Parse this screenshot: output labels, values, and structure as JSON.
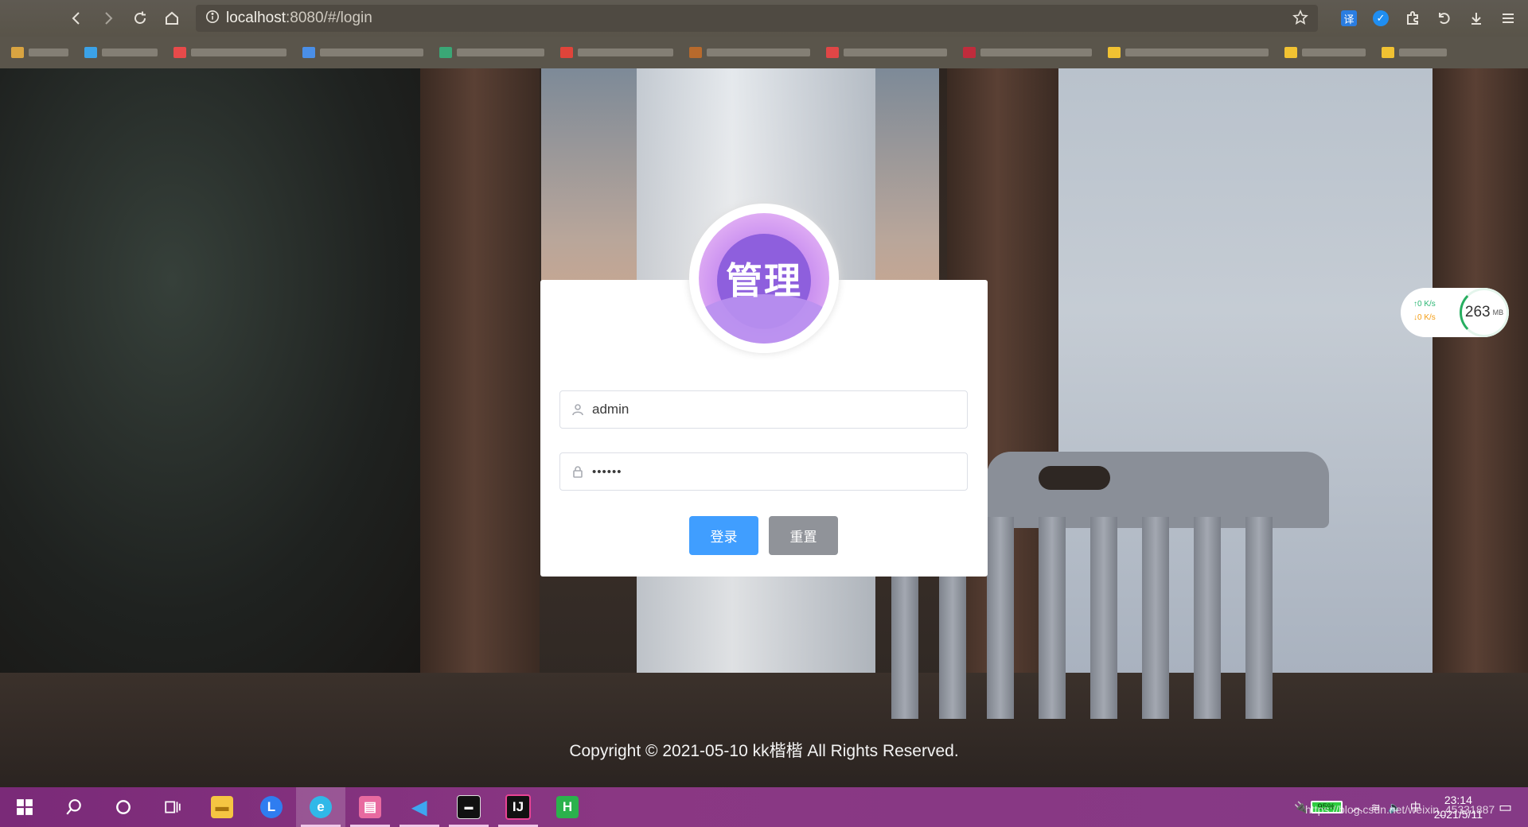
{
  "browser": {
    "url_host": "localhost",
    "url_rest": ":8080/#/login"
  },
  "login": {
    "avatar_text": "管理",
    "username_value": "admin",
    "password_value": "••••••",
    "login_button": "登录",
    "reset_button": "重置"
  },
  "footer": {
    "copyright": "Copyright © 2021-05-10 kk楷楷 All Rights Reserved."
  },
  "net_widget": {
    "up": "↑0  K/s",
    "down": "↓0  K/s",
    "memory": "263",
    "memory_unit": "MB"
  },
  "taskbar": {
    "battery": "95%",
    "ime": "中",
    "time": "23:14",
    "date": "2021/5/11",
    "watermark": "https://blog.csdn.net/weixin_45331887"
  },
  "colors": {
    "primary_button": "#409eff",
    "reset_button": "#909399",
    "taskbar": "#853a86"
  }
}
